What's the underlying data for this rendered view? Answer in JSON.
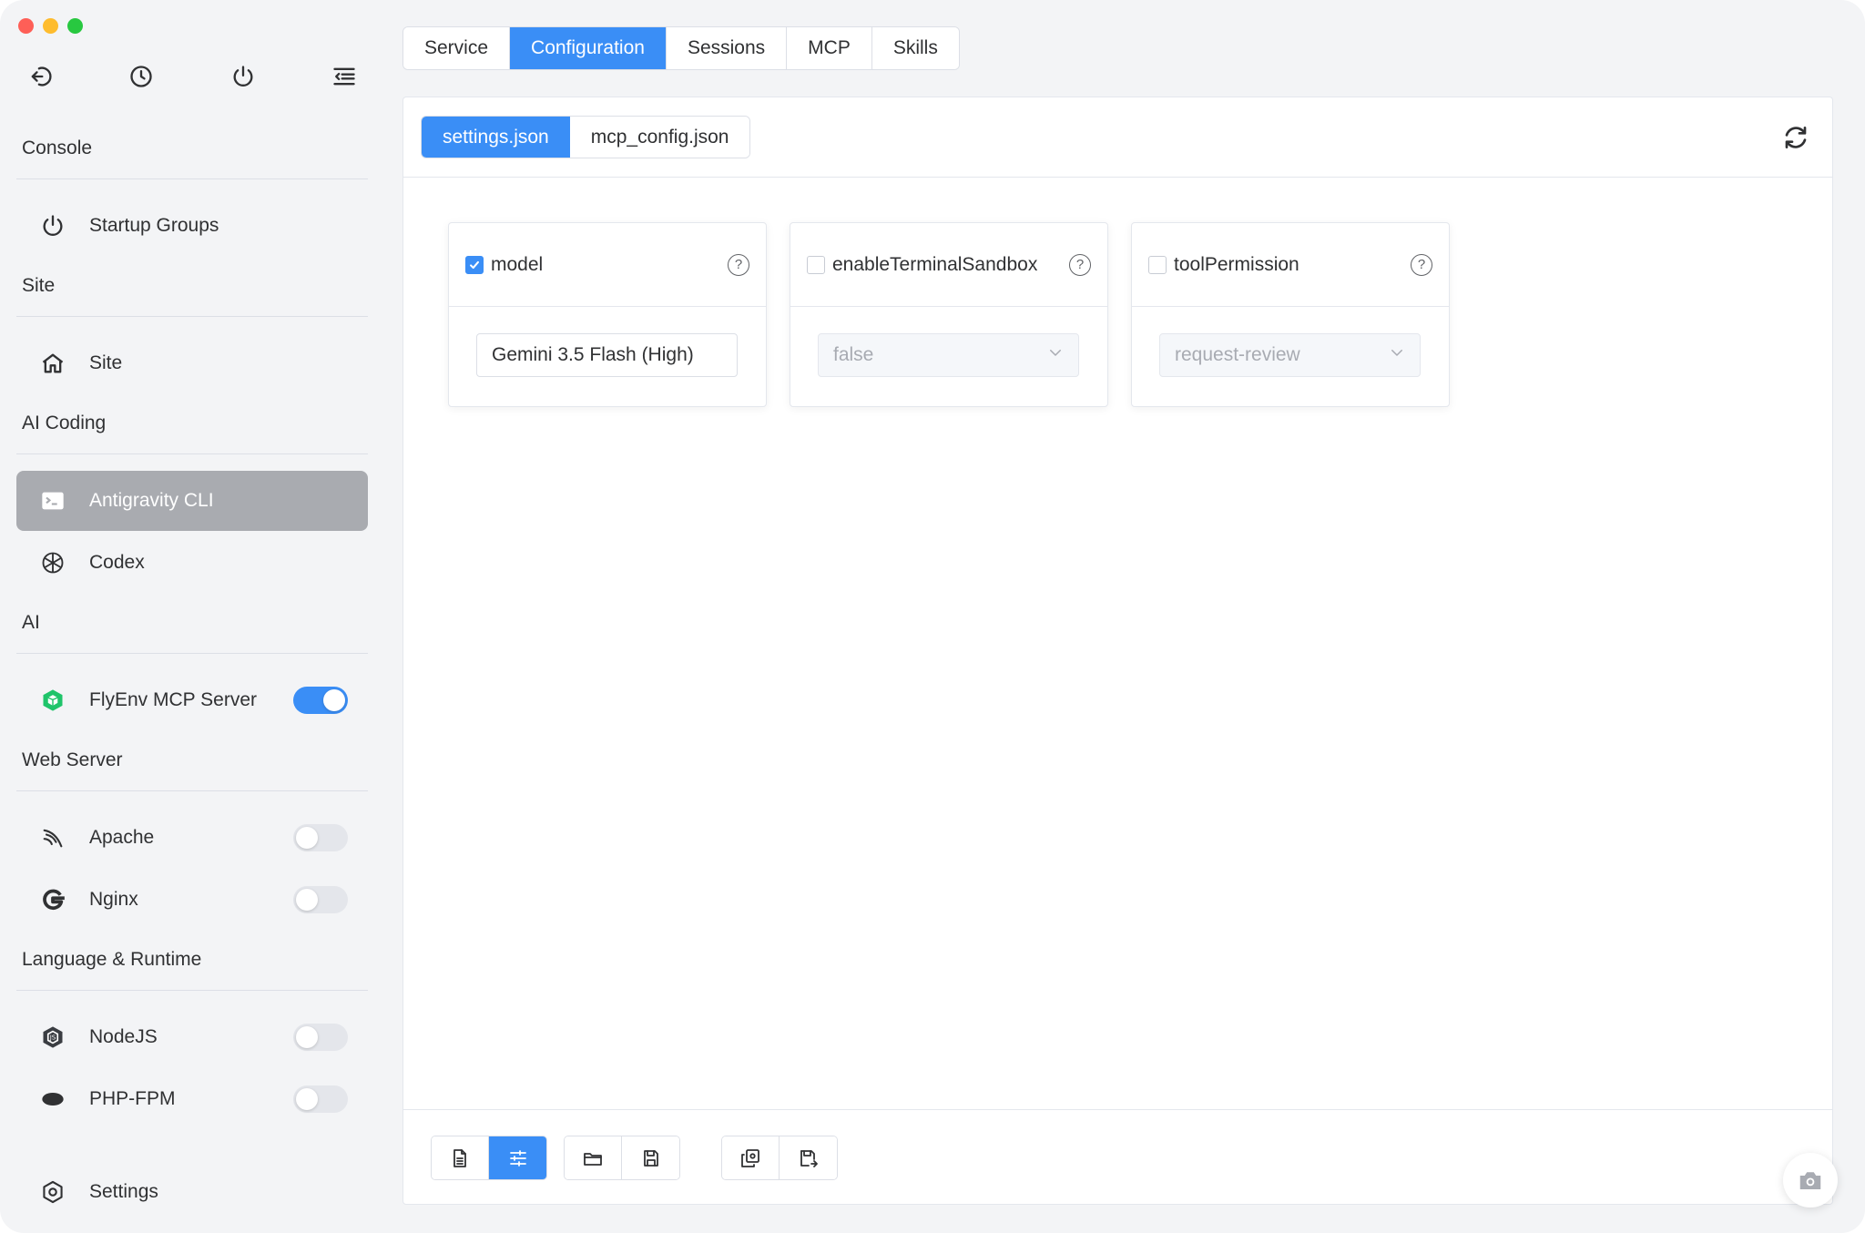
{
  "sidebar": {
    "top_icons": [
      "back-icon",
      "history-icon",
      "power-icon",
      "menu-collapse-icon"
    ],
    "sections": {
      "console": {
        "title": "Console",
        "items": [
          {
            "label": "Startup Groups",
            "icon": "power-icon"
          }
        ]
      },
      "site": {
        "title": "Site",
        "items": [
          {
            "label": "Site",
            "icon": "home-icon"
          }
        ]
      },
      "ai_coding": {
        "title": "AI Coding",
        "items": [
          {
            "label": "Antigravity CLI",
            "icon": "terminal-icon",
            "active": true
          },
          {
            "label": "Codex",
            "icon": "openai-icon"
          }
        ]
      },
      "ai": {
        "title": "AI",
        "items": [
          {
            "label": "FlyEnv MCP Server",
            "icon": "cube-icon",
            "toggle": true
          }
        ]
      },
      "web_server": {
        "title": "Web Server",
        "items": [
          {
            "label": "Apache",
            "icon": "feather-icon",
            "toggle": false
          },
          {
            "label": "Nginx",
            "icon": "nginx-icon",
            "toggle": false
          }
        ]
      },
      "language_runtime": {
        "title": "Language & Runtime",
        "items": [
          {
            "label": "NodeJS",
            "icon": "nodejs-icon",
            "toggle": false
          },
          {
            "label": "PHP-FPM",
            "icon": "php-icon",
            "toggle": false
          }
        ]
      }
    },
    "settings_label": "Settings"
  },
  "top_tabs": [
    "Service",
    "Configuration",
    "Sessions",
    "MCP",
    "Skills"
  ],
  "active_top_tab": "Configuration",
  "file_tabs": [
    "settings.json",
    "mcp_config.json"
  ],
  "active_file_tab": "settings.json",
  "cards": [
    {
      "title": "model",
      "checked": true,
      "value": "Gemini 3.5 Flash (High)",
      "kind": "input"
    },
    {
      "title": "enableTerminalSandbox",
      "checked": false,
      "value": "false",
      "kind": "select"
    },
    {
      "title": "toolPermission",
      "checked": false,
      "value": "request-review",
      "kind": "select"
    }
  ],
  "help_glyph": "?",
  "colors": {
    "accent": "#3a8ef6",
    "active_nav": "#a9abb0",
    "mcp_icon": "#1fc46a"
  }
}
